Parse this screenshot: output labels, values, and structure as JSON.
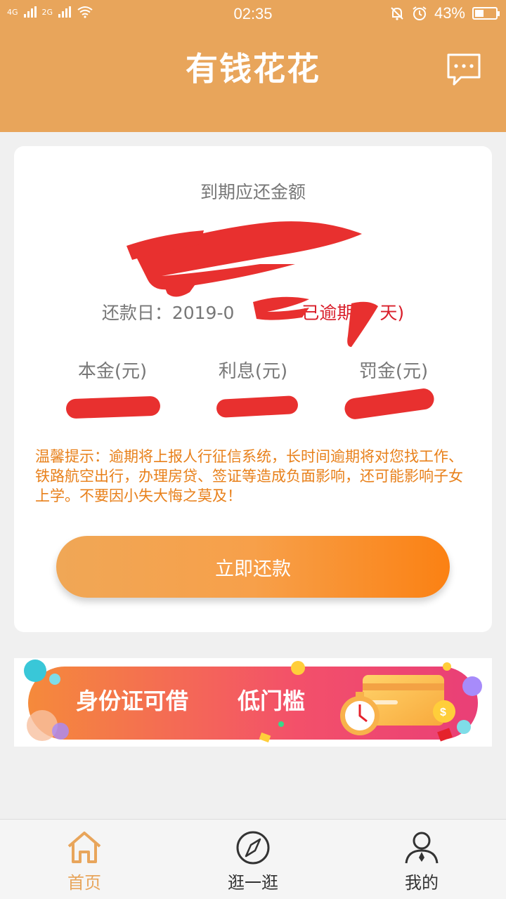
{
  "status_bar": {
    "time": "02:35",
    "battery_percent": "43%",
    "network_1": "4G",
    "network_2": "2G",
    "icons": [
      "signal-icon",
      "wifi-icon",
      "mute-icon",
      "alarm-icon",
      "battery-icon"
    ]
  },
  "header": {
    "title": "有钱花花",
    "message_icon": "chat-bubble-icon",
    "bg_color": "#e8a55b"
  },
  "repayment": {
    "due_label": "到期应还金额",
    "amount": "",
    "due_date_label": "还款日：",
    "due_date": "2019-0",
    "overdue_text": "已逾期",
    "overdue_unit": "天)",
    "columns": [
      {
        "label": "本金(元)",
        "value": ""
      },
      {
        "label": "利息(元)",
        "value": ""
      },
      {
        "label": "罚金(元)",
        "value": ""
      }
    ],
    "tip": "温馨提示：逾期将上报人行征信系统，长时间逾期将对您找工作、铁路航空出行，办理房贷、签证等造成负面影响，还可能影响子女上学。不要因小失大悔之莫及！",
    "pay_button": "立即还款"
  },
  "banner": {
    "text_1": "身份证可借",
    "text_2": "低门槛"
  },
  "bottom_nav": [
    {
      "label": "首页",
      "icon": "home-icon",
      "active": true
    },
    {
      "label": "逛一逛",
      "icon": "compass-icon",
      "active": false
    },
    {
      "label": "我的",
      "icon": "user-icon",
      "active": false
    }
  ],
  "colors": {
    "accent": "#e8a55b",
    "warning": "#e8801a",
    "overdue": "#d91e2a"
  }
}
